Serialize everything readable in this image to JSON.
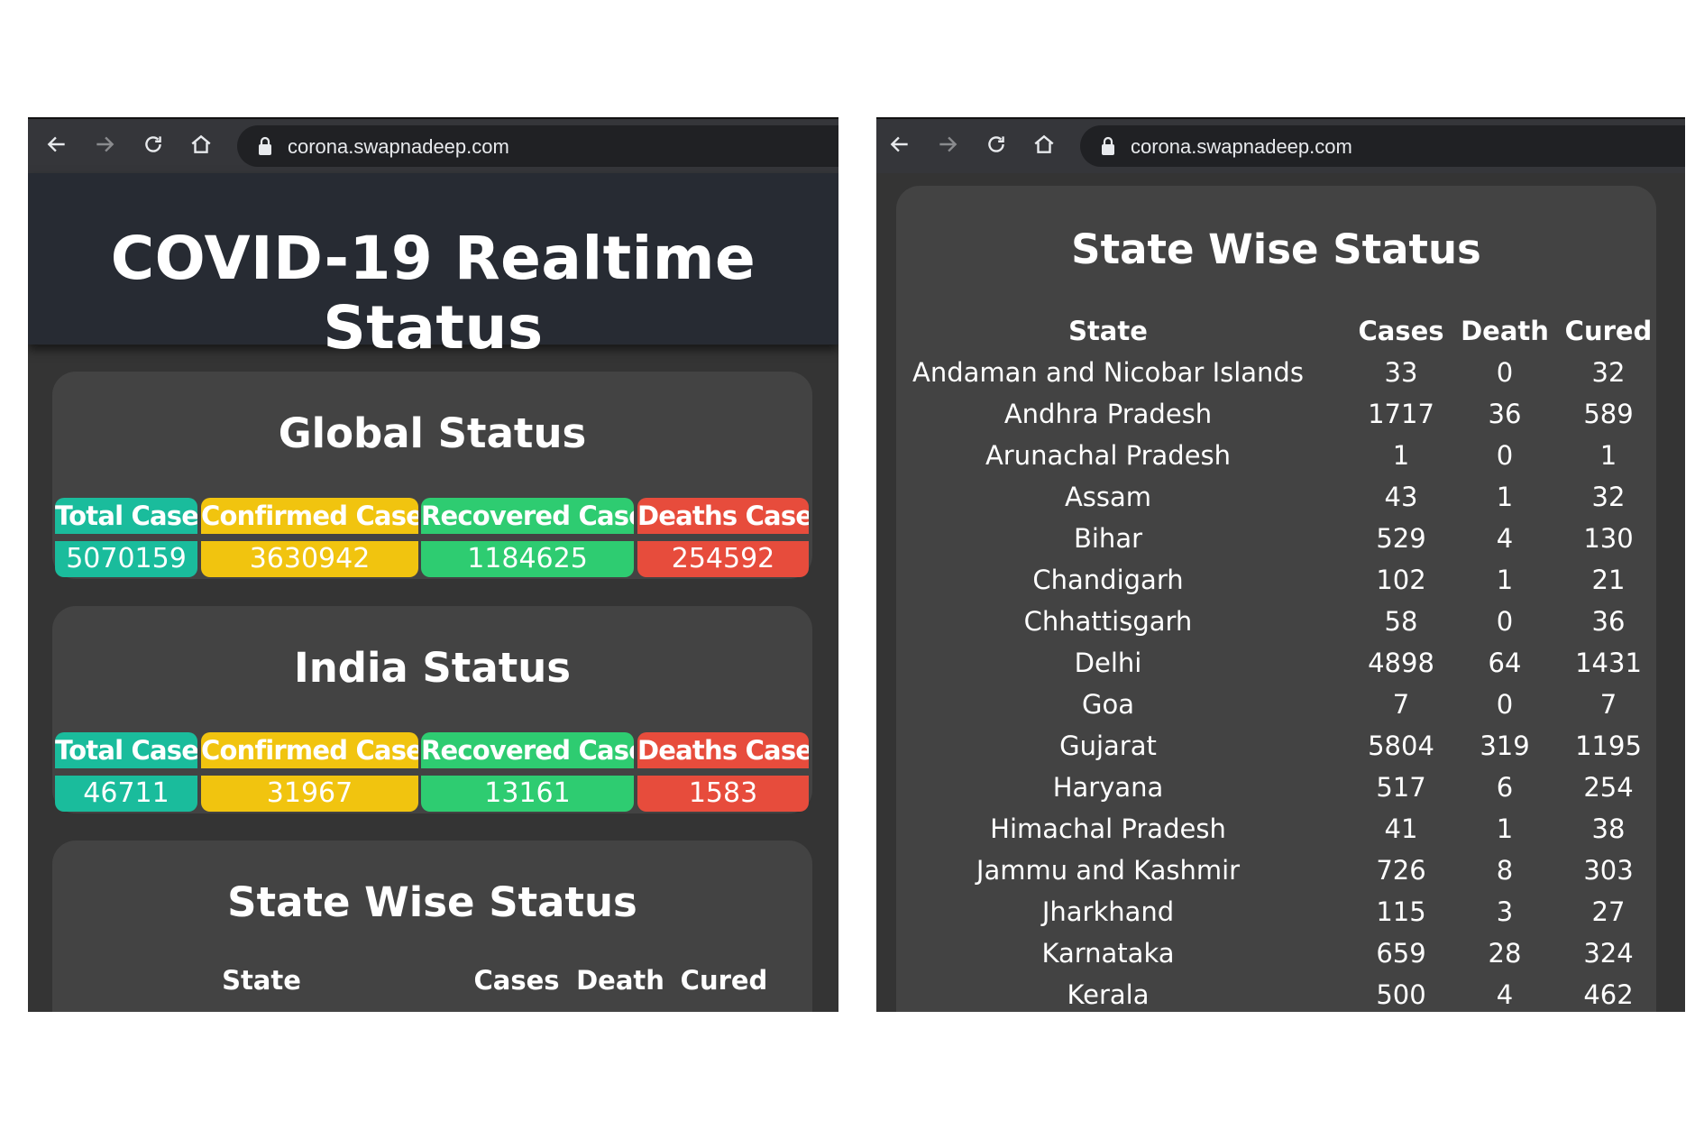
{
  "browser": {
    "url": "corona.swapnadeep.com"
  },
  "page": {
    "title": "COVID-19 Realtime Status",
    "global": {
      "title": "Global Status",
      "stats": [
        {
          "label": "Total Cases",
          "value": "5070159",
          "color": "#1abc9c"
        },
        {
          "label": "Confirmed Cases",
          "value": "3630942",
          "color": "#f1c40f"
        },
        {
          "label": "Recovered Cases",
          "value": "1184625",
          "color": "#2ecc71"
        },
        {
          "label": "Deaths Cases",
          "value": "254592",
          "color": "#e74c3c"
        }
      ]
    },
    "india": {
      "title": "India Status",
      "stats": [
        {
          "label": "Total Cases",
          "value": "46711",
          "color": "#1abc9c"
        },
        {
          "label": "Confirmed Cases",
          "value": "31967",
          "color": "#f1c40f"
        },
        {
          "label": "Recovered Cases",
          "value": "13161",
          "color": "#2ecc71"
        },
        {
          "label": "Deaths Cases",
          "value": "1583",
          "color": "#e74c3c"
        }
      ]
    },
    "state_wise": {
      "title": "State Wise Status",
      "columns": [
        "State",
        "Cases",
        "Death",
        "Cured"
      ],
      "rows": [
        [
          "Andaman and Nicobar Islands",
          "33",
          "0",
          "32"
        ],
        [
          "Andhra Pradesh",
          "1717",
          "36",
          "589"
        ],
        [
          "Arunachal Pradesh",
          "1",
          "0",
          "1"
        ],
        [
          "Assam",
          "43",
          "1",
          "32"
        ],
        [
          "Bihar",
          "529",
          "4",
          "130"
        ],
        [
          "Chandigarh",
          "102",
          "1",
          "21"
        ],
        [
          "Chhattisgarh",
          "58",
          "0",
          "36"
        ],
        [
          "Delhi",
          "4898",
          "64",
          "1431"
        ],
        [
          "Goa",
          "7",
          "0",
          "7"
        ],
        [
          "Gujarat",
          "5804",
          "319",
          "1195"
        ],
        [
          "Haryana",
          "517",
          "6",
          "254"
        ],
        [
          "Himachal Pradesh",
          "41",
          "1",
          "38"
        ],
        [
          "Jammu and Kashmir",
          "726",
          "8",
          "303"
        ],
        [
          "Jharkhand",
          "115",
          "3",
          "27"
        ],
        [
          "Karnataka",
          "659",
          "28",
          "324"
        ],
        [
          "Kerala",
          "500",
          "4",
          "462"
        ]
      ]
    }
  }
}
